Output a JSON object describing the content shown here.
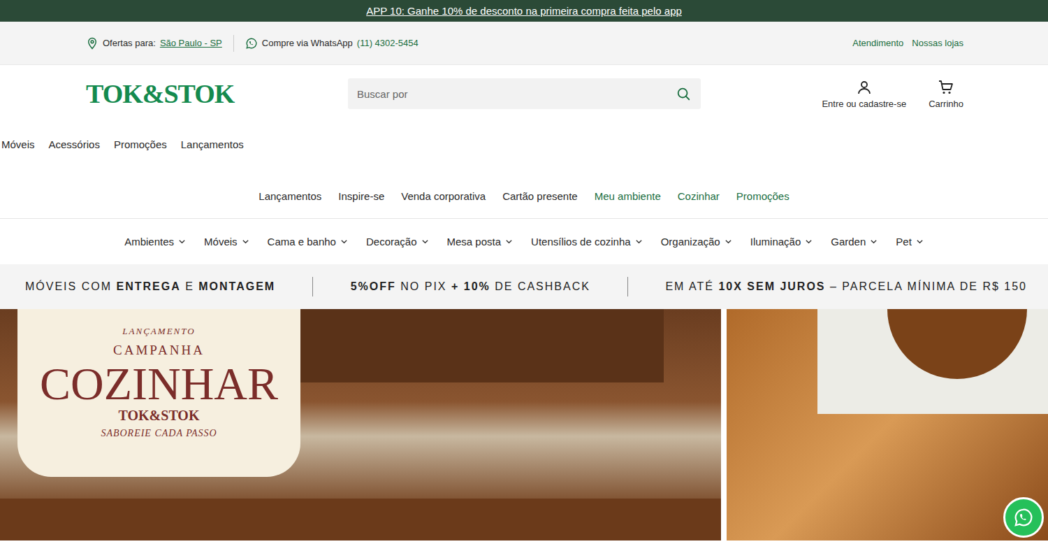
{
  "promo_banner": {
    "text": "APP 10: Ganhe 10% de desconto na primeira compra feita pelo app"
  },
  "utility_bar": {
    "location_label": "Ofertas para:",
    "location": "São Paulo - SP",
    "whatsapp_label": "Compre via WhatsApp",
    "whatsapp_number": "(11) 4302-5454",
    "links": [
      "Atendimento",
      "Nossas lojas"
    ]
  },
  "header": {
    "logo": "TOK&STOK",
    "search": {
      "placeholder": "Buscar por"
    },
    "account": "Entre ou cadastre-se",
    "cart": "Carrinho"
  },
  "quick_nav": [
    "Móveis",
    "Acessórios",
    "Promoções",
    "Lançamentos"
  ],
  "secondary_nav": [
    {
      "label": "Lançamentos",
      "highlighted": false
    },
    {
      "label": "Inspire-se",
      "highlighted": false
    },
    {
      "label": "Venda corporativa",
      "highlighted": false
    },
    {
      "label": "Cartão presente",
      "highlighted": false
    },
    {
      "label": "Meu ambiente",
      "highlighted": true
    },
    {
      "label": "Cozinhar",
      "highlighted": true
    },
    {
      "label": "Promoções",
      "highlighted": true
    }
  ],
  "categories": [
    {
      "label": "Ambientes",
      "has_dropdown": true
    },
    {
      "label": "Móveis",
      "has_dropdown": true
    },
    {
      "label": "Cama e banho",
      "has_dropdown": true
    },
    {
      "label": "Decoração",
      "has_dropdown": true
    },
    {
      "label": "Mesa posta",
      "has_dropdown": true
    },
    {
      "label": "Utensílios de cozinha",
      "has_dropdown": true
    },
    {
      "label": "Organização",
      "has_dropdown": true
    },
    {
      "label": "Iluminação",
      "has_dropdown": true
    },
    {
      "label": "Garden",
      "has_dropdown": true
    },
    {
      "label": "Pet",
      "has_dropdown": true
    }
  ],
  "benefits": [
    {
      "parts": [
        {
          "text": "MÓVEIS COM ",
          "bold": false
        },
        {
          "text": "ENTREGA",
          "bold": true
        },
        {
          "text": " E ",
          "bold": false
        },
        {
          "text": "MONTAGEM",
          "bold": true
        }
      ]
    },
    {
      "parts": [
        {
          "text": "5%OFF",
          "bold": true
        },
        {
          "text": " NO PIX ",
          "bold": false
        },
        {
          "text": "+ 10%",
          "bold": true
        },
        {
          "text": " DE CASHBACK",
          "bold": false
        }
      ]
    },
    {
      "parts": [
        {
          "text": "EM ATÉ ",
          "bold": false
        },
        {
          "text": "10X SEM JUROS",
          "bold": true
        },
        {
          "text": " – PARCELA MÍNIMA DE R$ 150",
          "bold": false
        }
      ]
    }
  ],
  "hero": {
    "card": {
      "tag": "LANÇAMENTO",
      "kicker": "CAMPANHA",
      "title": "COZINHAR",
      "brand": "TOK&STOK",
      "tagline": "SABOREIE CADA PASSO"
    }
  }
}
